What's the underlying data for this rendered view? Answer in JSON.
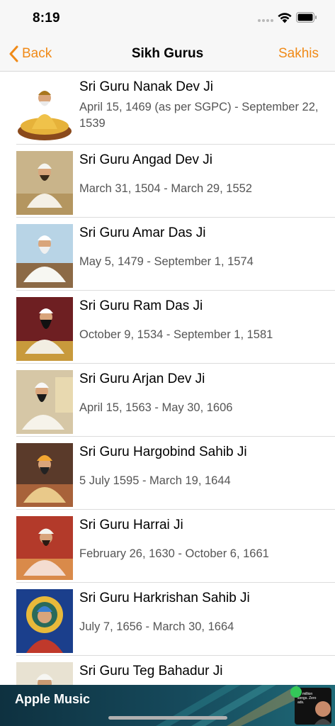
{
  "status_bar": {
    "time": "8:19"
  },
  "nav": {
    "back_label": "Back",
    "title": "Sikh Gurus",
    "right_label": "Sakhis",
    "accent_color": "#f08a17"
  },
  "gurus": [
    {
      "name": "Sri Guru Nanak Dev Ji",
      "dates": "April 15, 1469 (as per SGPC) - September 22, 1539"
    },
    {
      "name": "Sri Guru Angad Dev Ji",
      "dates": "March 31, 1504 - March 29, 1552"
    },
    {
      "name": "Sri Guru Amar Das Ji",
      "dates": "May 5, 1479 - September 1, 1574"
    },
    {
      "name": "Sri Guru Ram Das Ji",
      "dates": "October 9, 1534 - September 1, 1581"
    },
    {
      "name": "Sri Guru Arjan Dev Ji",
      "dates": "April 15, 1563 - May 30, 1606"
    },
    {
      "name": "Sri Guru Hargobind Sahib Ji",
      "dates": "5 July 1595 - March 19, 1644"
    },
    {
      "name": "Sri Guru Harrai Ji",
      "dates": "February 26, 1630 - October 6, 1661"
    },
    {
      "name": "Sri Guru Harkrishan Sahib Ji",
      "dates": "July 7, 1656 - March 30, 1664"
    },
    {
      "name": "Sri Guru Teg Bahadur Ji",
      "dates": ""
    }
  ],
  "ad": {
    "title": "Apple Music",
    "card_text": "90 million songs. Zero ads."
  }
}
